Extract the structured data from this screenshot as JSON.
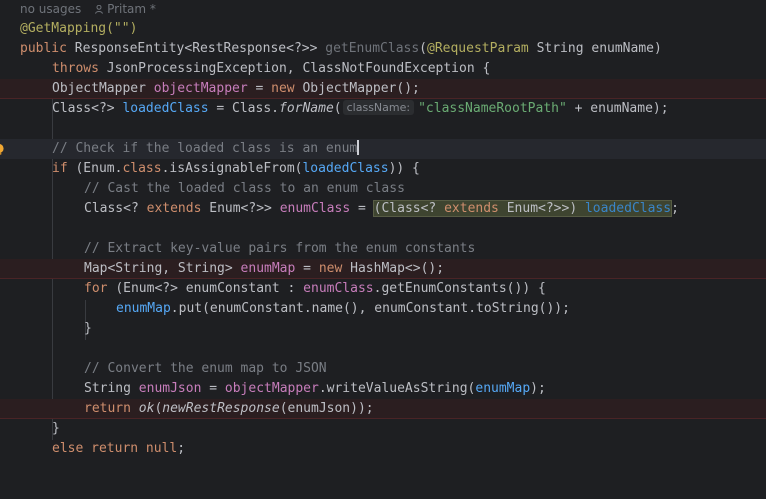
{
  "inlay_hints": {
    "usages": "no usages",
    "author": "Pritam *"
  },
  "code": {
    "line_getmapping": "@GetMapping(\"\")",
    "line_signature": {
      "public": "public ",
      "type": "ResponseEntity<RestResponse<?>> ",
      "method": "getEnumClass",
      "open": "(",
      "ann": "@RequestParam",
      "params": " String enumName)"
    },
    "line_throws": {
      "kw": "throws ",
      "rest": "JsonProcessingException, ClassNotFoundException {"
    },
    "line_objectmapper": {
      "type": "ObjectMapper ",
      "var": "objectMapper",
      "eq": " = ",
      "new": "new ",
      "rest": "ObjectMapper();"
    },
    "line_loadedclass": {
      "type": "Class<?> ",
      "var": "loadedClass",
      "eq": " = Class.",
      "method": "forName",
      "open": "(",
      "hint": "className:",
      "str": "\"classNameRootPath\"",
      "rest": " + enumName);"
    },
    "line_comment_check": "// Check if the loaded class is an enum",
    "line_if": {
      "kw": "if ",
      "a": "(Enum.",
      "cls": "class",
      "b": ".isAssignableFrom(",
      "var": "loadedClass",
      "c": ")) {"
    },
    "line_comment_cast": "// Cast the loaded class to an enum class",
    "line_enumclass": {
      "a": "Class<? ",
      "ext": "extends",
      "b": " Enum<?>> ",
      "var": "enumClass",
      "eq": " = ",
      "cast_a": "(Class<? ",
      "cast_ext": "extends",
      "cast_b": " Enum<?>>) ",
      "cast_var": "loadedClass",
      "end": ";"
    },
    "line_comment_extract": "// Extract key-value pairs from the enum constants",
    "line_map": {
      "type": "Map<String, String> ",
      "var": "enumMap",
      "eq": " = ",
      "new": "new ",
      "rest": "HashMap<>();"
    },
    "line_for": {
      "kw": "for ",
      "a": "(Enum<?> ",
      "var": "enumConstant",
      "b": " : ",
      "var2": "enumClass",
      "c": ".getEnumConstants()) {"
    },
    "line_put": {
      "var": "enumMap",
      "rest": ".put(enumConstant.name(), enumConstant.toString());"
    },
    "line_close_for": "}",
    "line_comment_convert": "// Convert the enum map to JSON",
    "line_json": {
      "type": "String ",
      "var": "enumJson",
      "eq": " = ",
      "obj": "objectMapper",
      "a": ".writeValueAsString(",
      "arg": "enumMap",
      "b": ");"
    },
    "line_return": {
      "kw": "return ",
      "ok": "ok",
      "a": "(",
      "nr": "newRestResponse",
      "b": "(enumJson));"
    },
    "line_close_if": "}",
    "line_else": {
      "kw": "else return null",
      "end": ";"
    }
  },
  "colors": {
    "background": "#1e1f22",
    "keyword": "#cf8e6d",
    "annotation": "#b3ae60",
    "string": "#6aab73",
    "field": "#c77dbb",
    "comment": "#7a7e85",
    "error_line": "#2b1e20"
  },
  "icons": {
    "person": "person-icon",
    "bulb": "lightbulb-icon"
  }
}
